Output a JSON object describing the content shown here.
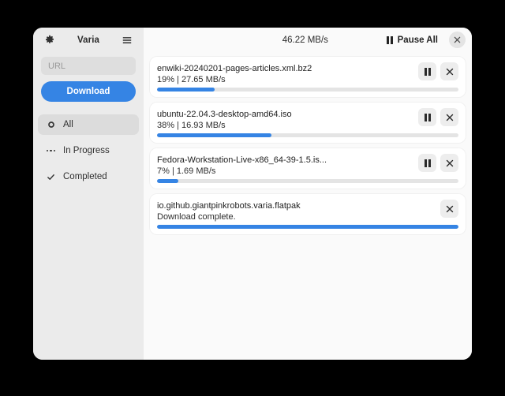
{
  "window": {
    "app_title": "Varia",
    "settings_icon": "gear-icon",
    "menu_icon": "hamburger-menu-icon",
    "close_icon": "close-icon"
  },
  "sidebar": {
    "url_input": {
      "value": "",
      "placeholder": "URL"
    },
    "download_button": "Download",
    "filters": [
      {
        "label": "All",
        "icon": "circle-record-icon",
        "selected": true
      },
      {
        "label": "In Progress",
        "icon": "ellipsis-icon",
        "selected": false
      },
      {
        "label": "Completed",
        "icon": "check-icon",
        "selected": false
      }
    ]
  },
  "header": {
    "total_speed": "46.22 MB/s",
    "pause_all_label": "Pause All",
    "pause_icon": "pause-icon"
  },
  "downloads": [
    {
      "name": "enwiki-20240201-pages-articles.xml.bz2",
      "status": "19% | 27.65 MB/s",
      "percent": 19,
      "has_pause": true
    },
    {
      "name": "ubuntu-22.04.3-desktop-amd64.iso",
      "status": "38% | 16.93 MB/s",
      "percent": 38,
      "has_pause": true
    },
    {
      "name": "Fedora-Workstation-Live-x86_64-39-1.5.is...",
      "status": "7% | 1.69 MB/s",
      "percent": 7,
      "has_pause": true
    },
    {
      "name": "io.github.giantpinkrobots.varia.flatpak",
      "status": "Download complete.",
      "percent": 100,
      "has_pause": false
    }
  ],
  "colors": {
    "accent": "#3584e4",
    "sidebar_bg": "#ebebeb",
    "main_bg": "#fafafa",
    "card_bg": "#ffffff",
    "track": "#e4e4e4"
  }
}
